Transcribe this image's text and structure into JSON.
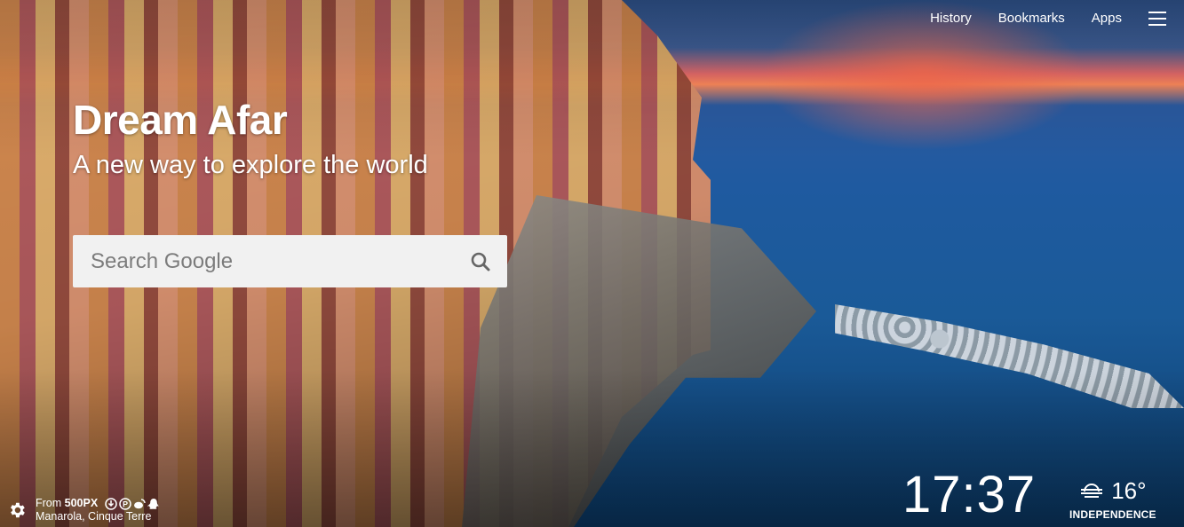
{
  "topnav": {
    "history": "History",
    "bookmarks": "Bookmarks",
    "apps": "Apps",
    "menu_icon": "hamburger-menu-icon"
  },
  "brand": {
    "title": "Dream Afar",
    "tagline": "A new way to explore the world"
  },
  "search": {
    "placeholder": "Search Google",
    "icon": "search-icon"
  },
  "photo_credit": {
    "prefix": "From",
    "source": "500PX",
    "location": "Manarola, Cinque Terre",
    "icons": [
      "download-icon",
      "pinterest-icon",
      "weibo-icon",
      "qq-icon"
    ]
  },
  "clock": {
    "time": "17:37"
  },
  "weather": {
    "temperature": "16°",
    "location": "INDEPENDENCE",
    "icon": "fog-icon"
  },
  "colors": {
    "text": "#ffffff",
    "search_bg": "#f1f1f1",
    "search_placeholder": "#7c7c7c"
  }
}
